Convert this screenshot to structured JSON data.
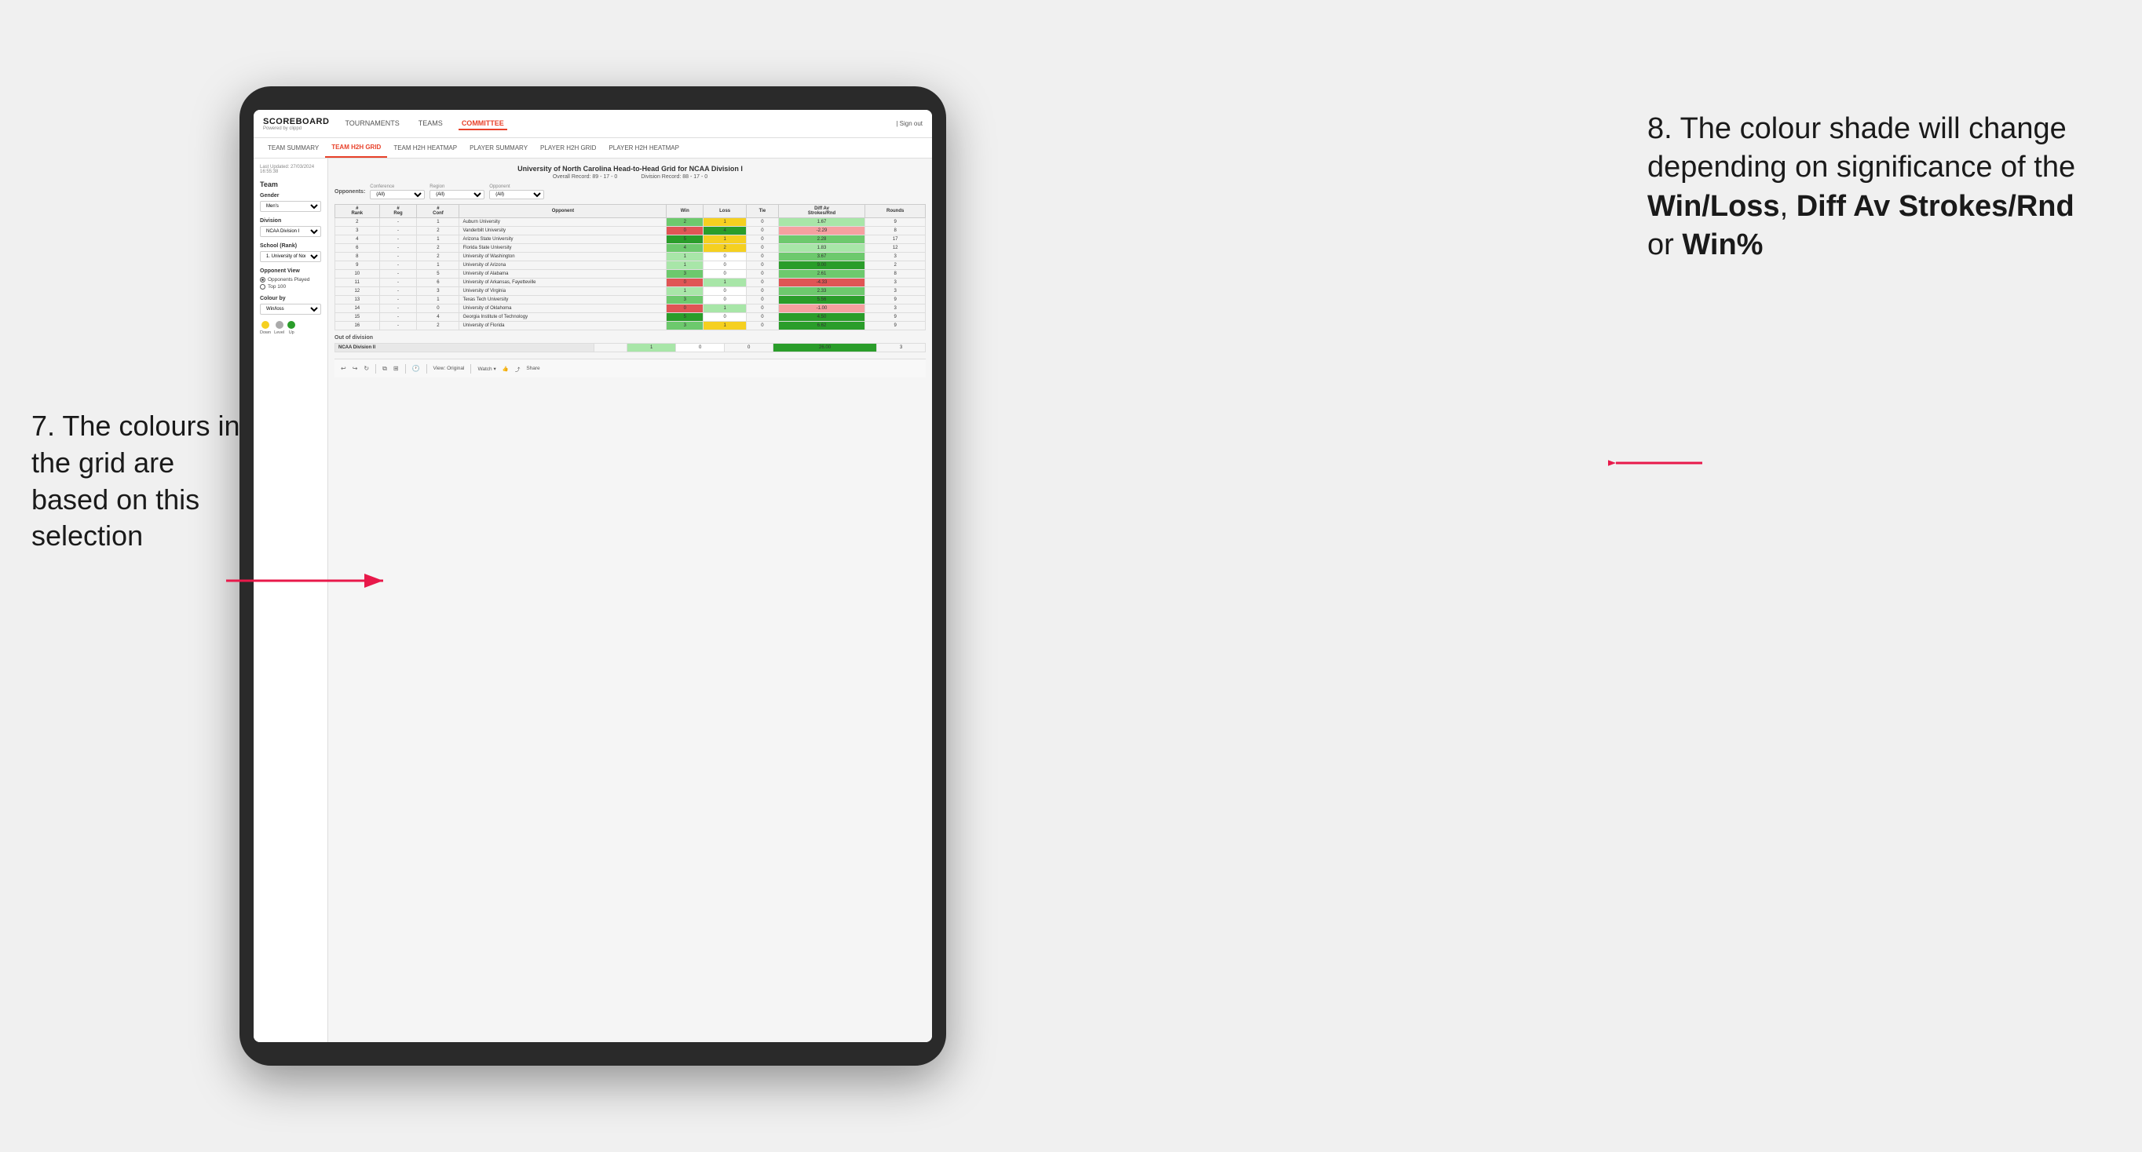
{
  "app": {
    "logo": "SCOREBOARD",
    "logo_sub": "Powered by clippd",
    "sign_out": "| Sign out",
    "nav": {
      "items": [
        {
          "label": "TOURNAMENTS",
          "active": false
        },
        {
          "label": "TEAMS",
          "active": false
        },
        {
          "label": "COMMITTEE",
          "active": true
        }
      ]
    },
    "sub_nav": {
      "items": [
        {
          "label": "TEAM SUMMARY",
          "active": false
        },
        {
          "label": "TEAM H2H GRID",
          "active": true
        },
        {
          "label": "TEAM H2H HEATMAP",
          "active": false
        },
        {
          "label": "PLAYER SUMMARY",
          "active": false
        },
        {
          "label": "PLAYER H2H GRID",
          "active": false
        },
        {
          "label": "PLAYER H2H HEATMAP",
          "active": false
        }
      ]
    }
  },
  "sidebar": {
    "last_updated_label": "Last Updated: 27/03/2024",
    "last_updated_time": "16:55:38",
    "team_label": "Team",
    "gender_label": "Gender",
    "gender_value": "Men's",
    "division_label": "Division",
    "division_value": "NCAA Division I",
    "school_label": "School (Rank)",
    "school_value": "1. University of Nort...",
    "opponent_view_label": "Opponent View",
    "opponent_option1": "Opponents Played",
    "opponent_option2": "Top 100",
    "colour_by_label": "Colour by",
    "colour_by_value": "Win/loss",
    "legend": {
      "down_label": "Down",
      "level_label": "Level",
      "up_label": "Up"
    }
  },
  "grid": {
    "title": "University of North Carolina Head-to-Head Grid for NCAA Division I",
    "overall_record_label": "Overall Record:",
    "overall_record": "89 - 17 - 0",
    "division_record_label": "Division Record:",
    "division_record": "88 - 17 - 0",
    "filter_opponents_label": "Opponents:",
    "filter_conference_label": "Conference",
    "filter_conference_value": "(All)",
    "filter_region_label": "Region",
    "filter_region_value": "(All)",
    "filter_opponent_label": "Opponent",
    "filter_opponent_value": "(All)",
    "table_headers": {
      "rank": "#\nRank",
      "reg": "#\nReg",
      "conf": "#\nConf",
      "opponent": "Opponent",
      "win": "Win",
      "loss": "Loss",
      "tie": "Tie",
      "diff_av": "Diff Av\nStrokes/Rnd",
      "rounds": "Rounds"
    },
    "rows": [
      {
        "rank": "2",
        "reg": "-",
        "conf": "1",
        "opponent": "Auburn University",
        "win": "2",
        "loss": "1",
        "tie": "0",
        "diff": "1.67",
        "rounds": "9",
        "win_class": "cell-green",
        "loss_class": "cell-yellow",
        "diff_class": "cell-green-light"
      },
      {
        "rank": "3",
        "reg": "-",
        "conf": "2",
        "opponent": "Vanderbilt University",
        "win": "0",
        "loss": "4",
        "tie": "0",
        "diff": "-2.29",
        "rounds": "8",
        "win_class": "cell-red",
        "loss_class": "cell-green-dark",
        "diff_class": "cell-red-light"
      },
      {
        "rank": "4",
        "reg": "-",
        "conf": "1",
        "opponent": "Arizona State University",
        "win": "5",
        "loss": "1",
        "tie": "0",
        "diff": "2.28",
        "rounds": "17",
        "win_class": "cell-green-dark",
        "loss_class": "cell-yellow",
        "diff_class": "cell-green"
      },
      {
        "rank": "6",
        "reg": "-",
        "conf": "2",
        "opponent": "Florida State University",
        "win": "4",
        "loss": "2",
        "tie": "0",
        "diff": "1.83",
        "rounds": "12",
        "win_class": "cell-green",
        "loss_class": "cell-yellow",
        "diff_class": "cell-green-light"
      },
      {
        "rank": "8",
        "reg": "-",
        "conf": "2",
        "opponent": "University of Washington",
        "win": "1",
        "loss": "0",
        "tie": "0",
        "diff": "3.67",
        "rounds": "3",
        "win_class": "cell-green-light",
        "loss_class": "cell-neutral",
        "diff_class": "cell-green"
      },
      {
        "rank": "9",
        "reg": "-",
        "conf": "1",
        "opponent": "University of Arizona",
        "win": "1",
        "loss": "0",
        "tie": "0",
        "diff": "9.00",
        "rounds": "2",
        "win_class": "cell-green-light",
        "loss_class": "cell-neutral",
        "diff_class": "cell-green-dark"
      },
      {
        "rank": "10",
        "reg": "-",
        "conf": "5",
        "opponent": "University of Alabama",
        "win": "3",
        "loss": "0",
        "tie": "0",
        "diff": "2.61",
        "rounds": "8",
        "win_class": "cell-green",
        "loss_class": "cell-neutral",
        "diff_class": "cell-green"
      },
      {
        "rank": "11",
        "reg": "-",
        "conf": "6",
        "opponent": "University of Arkansas, Fayetteville",
        "win": "0",
        "loss": "1",
        "tie": "0",
        "diff": "-4.33",
        "rounds": "3",
        "win_class": "cell-red",
        "loss_class": "cell-green-light",
        "diff_class": "cell-red"
      },
      {
        "rank": "12",
        "reg": "-",
        "conf": "3",
        "opponent": "University of Virginia",
        "win": "1",
        "loss": "0",
        "tie": "0",
        "diff": "2.33",
        "rounds": "3",
        "win_class": "cell-green-light",
        "loss_class": "cell-neutral",
        "diff_class": "cell-green"
      },
      {
        "rank": "13",
        "reg": "-",
        "conf": "1",
        "opponent": "Texas Tech University",
        "win": "3",
        "loss": "0",
        "tie": "0",
        "diff": "5.56",
        "rounds": "9",
        "win_class": "cell-green",
        "loss_class": "cell-neutral",
        "diff_class": "cell-green-dark"
      },
      {
        "rank": "14",
        "reg": "-",
        "conf": "0",
        "opponent": "University of Oklahoma",
        "win": "0",
        "loss": "1",
        "tie": "0",
        "diff": "-1.00",
        "rounds": "3",
        "win_class": "cell-red",
        "loss_class": "cell-green-light",
        "diff_class": "cell-red-light"
      },
      {
        "rank": "15",
        "reg": "-",
        "conf": "4",
        "opponent": "Georgia Institute of Technology",
        "win": "5",
        "loss": "0",
        "tie": "0",
        "diff": "4.50",
        "rounds": "9",
        "win_class": "cell-green-dark",
        "loss_class": "cell-neutral",
        "diff_class": "cell-green-dark"
      },
      {
        "rank": "16",
        "reg": "-",
        "conf": "2",
        "opponent": "University of Florida",
        "win": "3",
        "loss": "1",
        "tie": "0",
        "diff": "6.62",
        "rounds": "9",
        "win_class": "cell-green",
        "loss_class": "cell-yellow",
        "diff_class": "cell-green-dark"
      }
    ],
    "out_of_division_label": "Out of division",
    "out_of_division_rows": [
      {
        "division": "NCAA Division II",
        "win": "1",
        "loss": "0",
        "tie": "0",
        "diff": "26.00",
        "rounds": "3",
        "win_class": "cell-green-light",
        "loss_class": "cell-neutral",
        "diff_class": "cell-green-dark"
      }
    ]
  },
  "toolbar": {
    "view_label": "View: Original",
    "watch_label": "Watch ▾",
    "share_label": "Share"
  },
  "annotations": {
    "left": {
      "text": "7. The colours in the grid are based on this selection"
    },
    "right": {
      "text_before": "8. The colour shade will change depending on significance of the ",
      "bold1": "Win/Loss",
      "sep1": ", ",
      "bold2": "Diff Av Strokes/Rnd",
      "sep2": " or ",
      "bold3": "Win%"
    }
  }
}
